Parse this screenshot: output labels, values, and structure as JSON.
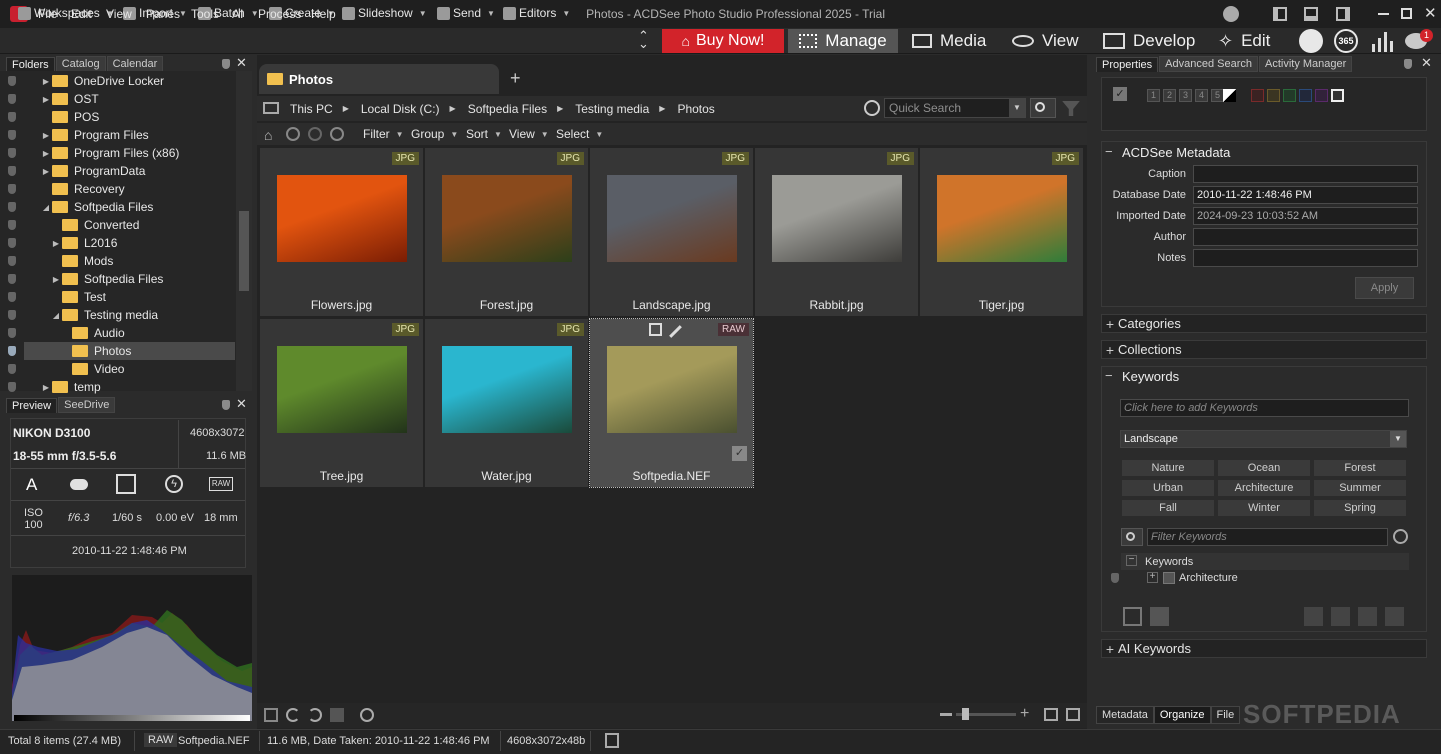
{
  "window": {
    "title": "Photos - ACDSee Photo Studio Professional 2025 - Trial"
  },
  "menu": [
    "File",
    "Edit",
    "View",
    "Panes",
    "Tools",
    "AI",
    "Process",
    "Help"
  ],
  "toolbar": {
    "workspaces": "Workspaces",
    "import": "Import",
    "batch": "Batch",
    "create": "Create",
    "slideshow": "Slideshow",
    "send": "Send",
    "editors": "Editors"
  },
  "modes": {
    "buy_now": "Buy Now!",
    "manage": "Manage",
    "media": "Media",
    "view": "View",
    "develop": "Develop",
    "edit": "Edit",
    "badge365": "365",
    "notif_count": "1"
  },
  "left_tabs": [
    "Folders",
    "Catalog",
    "Calendar"
  ],
  "folders": [
    {
      "label": "OneDrive Locker",
      "arrow": "▶"
    },
    {
      "label": "OST",
      "arrow": "▶"
    },
    {
      "label": "POS",
      "arrow": ""
    },
    {
      "label": "Program Files",
      "arrow": "▶"
    },
    {
      "label": "Program Files (x86)",
      "arrow": "▶"
    },
    {
      "label": "ProgramData",
      "arrow": "▶"
    },
    {
      "label": "Recovery",
      "arrow": ""
    },
    {
      "label": "Softpedia Files",
      "arrow": "◢"
    },
    {
      "label": "Converted",
      "arrow": ""
    },
    {
      "label": "L2016",
      "arrow": "▶"
    },
    {
      "label": "Mods",
      "arrow": ""
    },
    {
      "label": "Softpedia Files",
      "arrow": "▶"
    },
    {
      "label": "Test",
      "arrow": ""
    },
    {
      "label": "Testing media",
      "arrow": "◢"
    },
    {
      "label": "Audio",
      "arrow": ""
    },
    {
      "label": "Photos",
      "arrow": ""
    },
    {
      "label": "Video",
      "arrow": ""
    },
    {
      "label": "temp",
      "arrow": "▶"
    }
  ],
  "preview": {
    "tabs": [
      "Preview",
      "SeeDrive"
    ],
    "camera": "NIKON D3100",
    "resolution": "4608x3072",
    "lens": "18-55 mm f/3.5-5.6",
    "size": "11.6 MB",
    "mode_letter": "A",
    "raw_label": "RAW",
    "iso_label": "ISO",
    "iso": "100",
    "aperture": "f/6.3",
    "shutter": "1/60 s",
    "ev": "0.00 eV",
    "focal": "18 mm",
    "date": "2010-11-22 1:48:46 PM"
  },
  "tab_title": "Photos",
  "breadcrumb": [
    "This PC",
    "Local Disk (C:)",
    "Softpedia Files",
    "Testing media",
    "Photos"
  ],
  "search_placeholder": "Quick Search",
  "filterbar": {
    "filter": "Filter",
    "group": "Group",
    "sort": "Sort",
    "view": "View",
    "select": "Select"
  },
  "thumbs": [
    {
      "name": "Flowers.jpg",
      "type": "JPG",
      "c1": "#e2540f",
      "c2": "#7a1d04"
    },
    {
      "name": "Forest.jpg",
      "type": "JPG",
      "c1": "#8a4a1c",
      "c2": "#2c3f1a"
    },
    {
      "name": "Landscape.jpg",
      "type": "JPG",
      "c1": "#5a5e66",
      "c2": "#6a3a20"
    },
    {
      "name": "Rabbit.jpg",
      "type": "JPG",
      "c1": "#9b9b96",
      "c2": "#3e3d3a"
    },
    {
      "name": "Tiger.jpg",
      "type": "JPG",
      "c1": "#d0742a",
      "c2": "#2f7d3a"
    },
    {
      "name": "Tree.jpg",
      "type": "JPG",
      "c1": "#5f8a2c",
      "c2": "#22331a"
    },
    {
      "name": "Water.jpg",
      "type": "JPG",
      "c1": "#2ab6cf",
      "c2": "#1a4a3a"
    },
    {
      "name": "Softpedia.NEF",
      "type": "RAW",
      "c1": "#a49a5a",
      "c2": "#4a5030"
    }
  ],
  "right_tabs": [
    "Properties",
    "Advanced Search",
    "Activity Manager"
  ],
  "metadata": {
    "title": "ACDSee Metadata",
    "fields": [
      {
        "label": "Caption",
        "value": ""
      },
      {
        "label": "Database Date",
        "value": "2010-11-22 1:48:46 PM"
      },
      {
        "label": "Imported Date",
        "value": "2024-09-23 10:03:52 AM"
      },
      {
        "label": "Author",
        "value": ""
      },
      {
        "label": "Notes",
        "value": ""
      }
    ],
    "apply": "Apply",
    "ratings": [
      "1",
      "2",
      "3",
      "4",
      "5"
    ]
  },
  "sections": {
    "categories": "Categories",
    "collections": "Collections",
    "keywords": "Keywords",
    "ai_keywords": "AI Keywords"
  },
  "keywords": {
    "add_placeholder": "Click here to add Keywords",
    "set": "Landscape",
    "quick": [
      "Nature",
      "Ocean",
      "Forest",
      "Urban",
      "Architecture",
      "Summer",
      "Fall",
      "Winter",
      "Spring"
    ],
    "filter_placeholder": "Filter Keywords",
    "tree_root": "Keywords",
    "tree_child": "Architecture"
  },
  "bottom_tabs": [
    "Metadata",
    "Organize",
    "File"
  ],
  "status": {
    "total": "Total 8 items  (27.4 MB)",
    "raw": "RAW",
    "file": "Softpedia.NEF",
    "info": "11.6 MB, Date Taken: 2010-11-22 1:48:46 PM",
    "dims": "4608x3072x48b"
  },
  "watermark": "SOFTPEDIA"
}
